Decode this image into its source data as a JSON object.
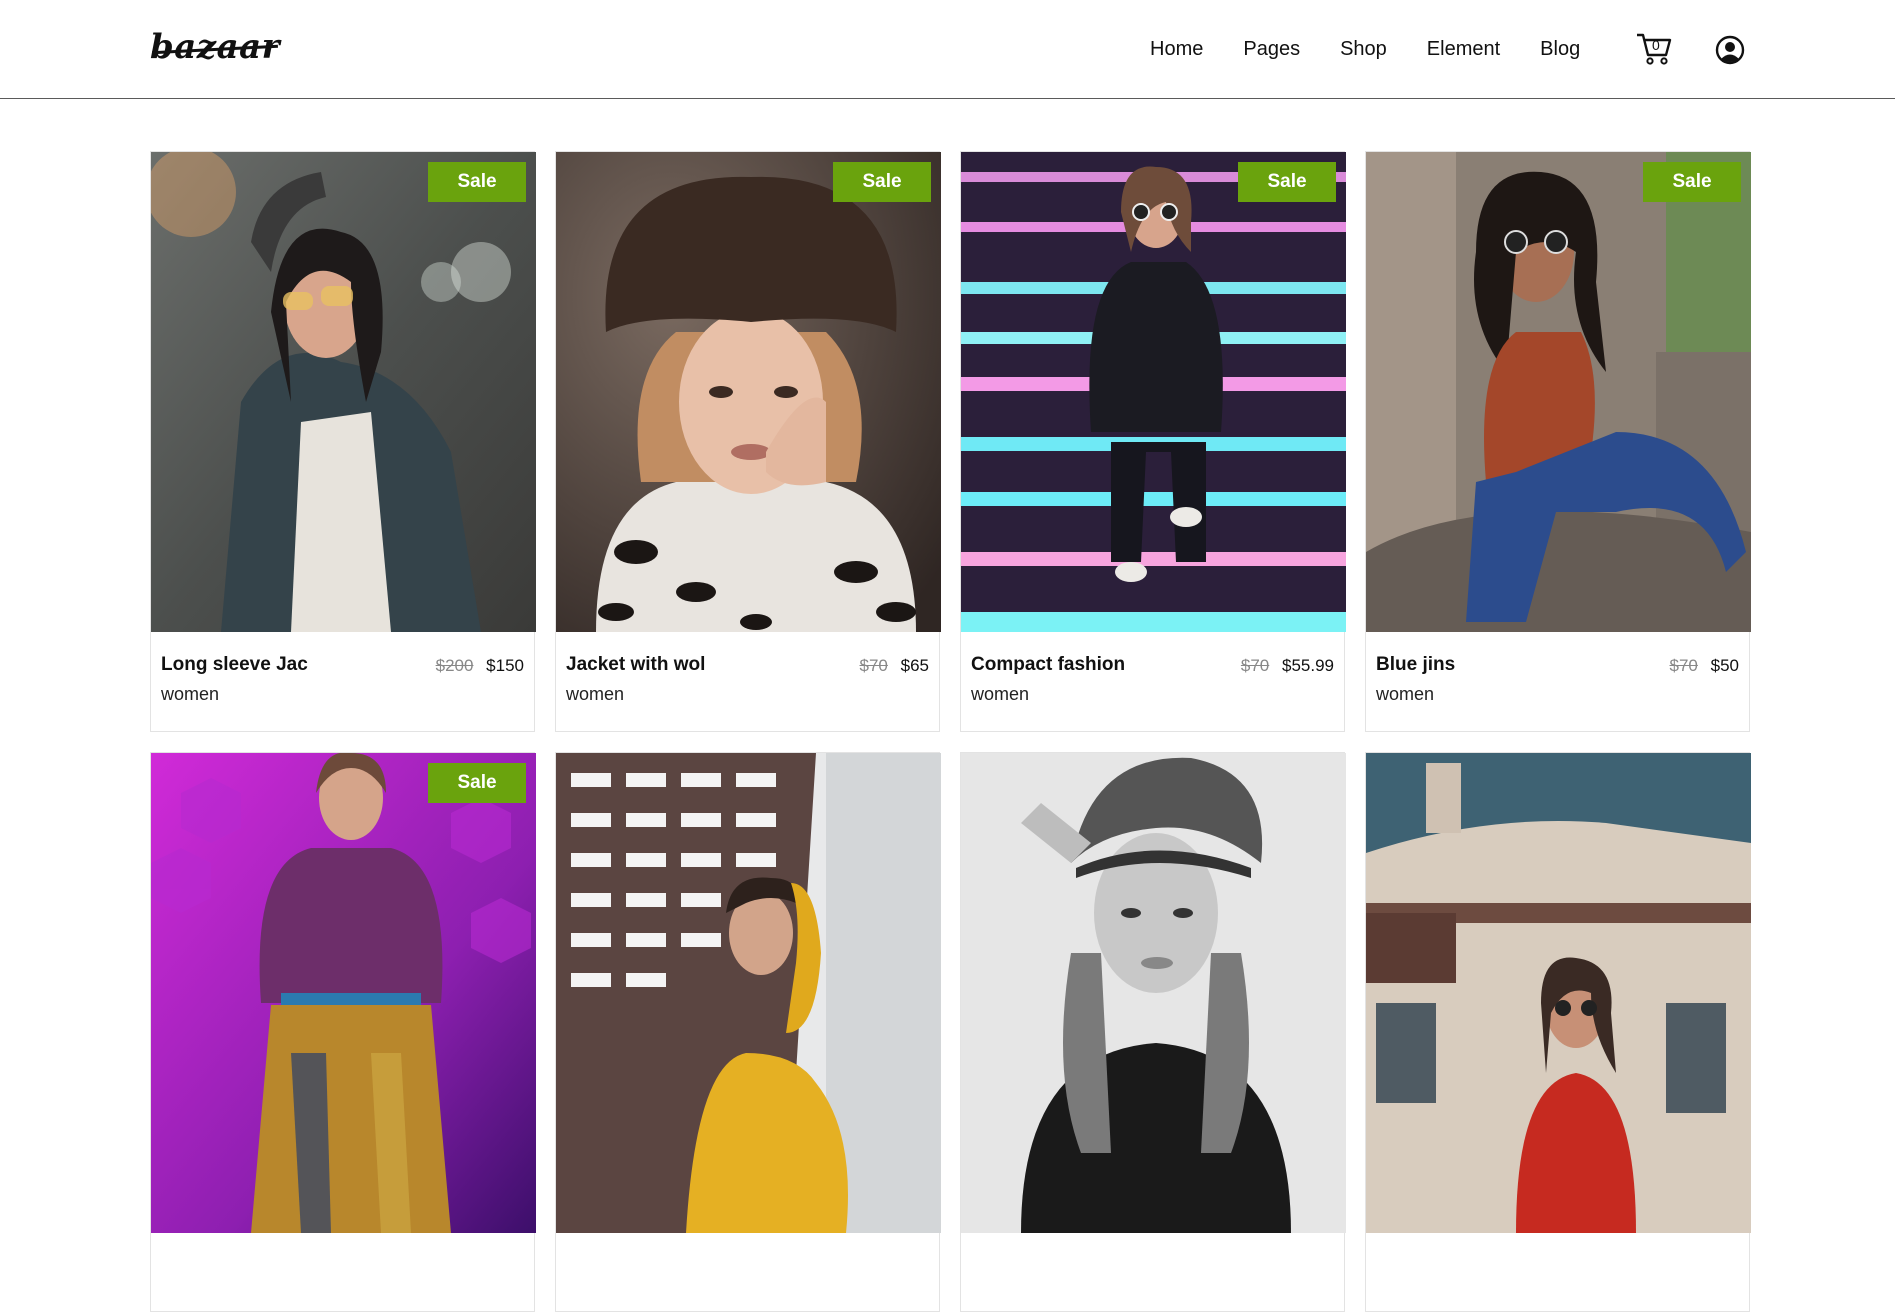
{
  "header": {
    "logo": "bazaar",
    "nav": [
      "Home",
      "Pages",
      "Shop",
      "Element",
      "Blog"
    ],
    "cart_count": "0",
    "icons": [
      "cart-icon",
      "user-icon"
    ]
  },
  "colors": {
    "sale_badge": "#6aa30d",
    "text": "#111111",
    "old_price": "#888888"
  },
  "products": [
    {
      "title": "Long sleeve Jac",
      "category": "women",
      "old_price": "$200",
      "price": "$150",
      "badge": "Sale"
    },
    {
      "title": "Jacket with wol",
      "category": "women",
      "old_price": "$70",
      "price": "$65",
      "badge": "Sale"
    },
    {
      "title": "Compact fashion",
      "category": "women",
      "old_price": "$70",
      "price": "$55.99",
      "badge": "Sale"
    },
    {
      "title": "Blue jins",
      "category": "women",
      "old_price": "$70",
      "price": "$50",
      "badge": "Sale"
    },
    {
      "badge": "Sale"
    },
    {},
    {},
    {}
  ]
}
